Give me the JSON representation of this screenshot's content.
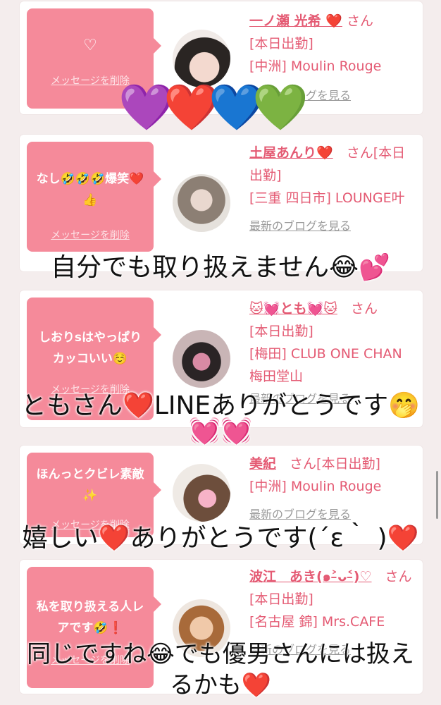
{
  "cards": [
    {
      "bubble_text": "♡",
      "delete_label": "メッセージを削除",
      "name": "一ノ瀬 光希 ❤️",
      "honorific": "さん",
      "lines": [
        "[本日出勤]",
        "[中洲] Moulin Rouge"
      ],
      "blog": "最新のブログを見る"
    },
    {
      "bubble_text": "なし🤣🤣🤣爆笑❤️👍",
      "delete_label": "メッセージを削除",
      "name": "土屋あんり❤️",
      "honorific": "さん[本日出勤]",
      "lines": [
        "[三重 四日市] LOUNGE叶"
      ],
      "blog": "最新のブログを見る"
    },
    {
      "bubble_text": "しおりsはやっぱりカッコいい☺️",
      "delete_label": "メッセージを削除",
      "name": "🐱💓とも💓🐱",
      "honorific": "さん",
      "lines": [
        "[本日出勤]",
        "[梅田] CLUB ONE CHAN 梅田堂山"
      ],
      "blog": "最新のブログを見る"
    },
    {
      "bubble_text": "ほんっとクビレ素敵✨",
      "delete_label": "メッセージを削除",
      "name": "美紀",
      "honorific": "さん[本日出勤]",
      "lines": [
        "[中洲] Moulin Rouge"
      ],
      "blog": "最新のブログを見る"
    },
    {
      "bubble_text": "私を取り扱える人レアです🤣❗️",
      "delete_label": "メッセージを削除",
      "name": "波江　あき(๑˃̵ᴗ˂̵)♡",
      "honorific": "さん[本日出勤]",
      "lines": [
        "[名古屋 錦] Mrs.CAFE"
      ],
      "blog": "最新のブログを見る"
    }
  ],
  "overlays": {
    "hearts": [
      "💜",
      "❤️",
      "💙",
      "💚"
    ],
    "t1": "自分でも取り扱えません😂💕",
    "t2": "ともさん❤️LINEありがとうです🤭",
    "t2b": "💓💓",
    "t3": "嬉しい❤️ありがとうです(´ε｀ )❤️",
    "t4": "同じですね😂でも優男さんには扱え",
    "t4b": "るかも❤️"
  },
  "colors": {
    "accent": "#f58a9a",
    "name": "#e45a73"
  }
}
